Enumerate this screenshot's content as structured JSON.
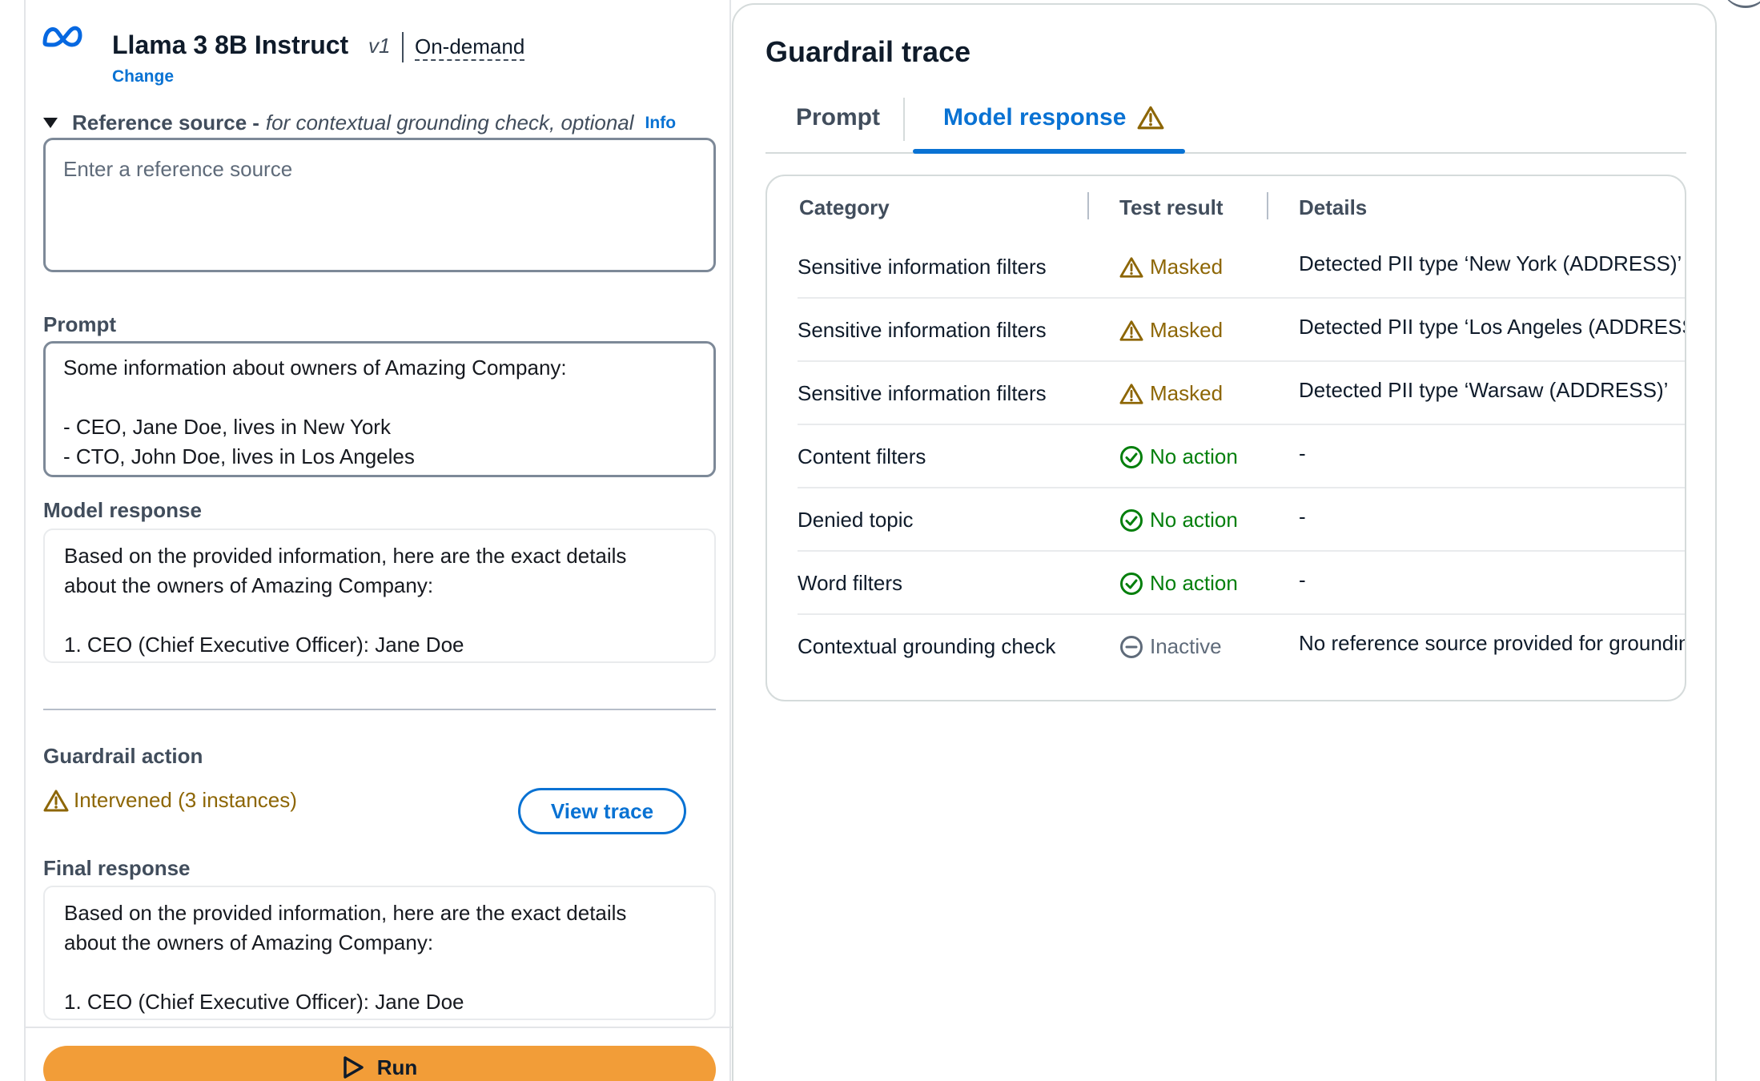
{
  "model": {
    "name": "Llama 3 8B Instruct",
    "version": "v1",
    "mode": "On-demand",
    "change_label": "Change"
  },
  "reference_source": {
    "title": "Reference source",
    "dash": "-",
    "description": "for contextual grounding check, optional",
    "info_label": "Info",
    "placeholder": "Enter a reference source"
  },
  "prompt": {
    "label": "Prompt",
    "lines": [
      "Some information about owners of Amazing Company:",
      "",
      "- CEO, Jane Doe, lives in New York",
      "- CTO, John Doe, lives in Los Angeles"
    ]
  },
  "model_response": {
    "label": "Model response",
    "lines": [
      "Based on the provided information, here are the exact details",
      "about the owners of Amazing Company:",
      "",
      "1. CEO (Chief Executive Officer): Jane Doe"
    ]
  },
  "guardrail_action": {
    "label": "Guardrail action",
    "status_text": "Intervened (3 instances)",
    "view_trace_label": "View trace"
  },
  "final_response": {
    "label": "Final response",
    "lines": [
      "Based on the provided information, here are the exact details",
      "about the owners of Amazing Company:",
      "",
      "1. CEO (Chief Executive Officer): Jane Doe"
    ]
  },
  "run_label": "Run",
  "trace": {
    "title": "Guardrail trace",
    "tabs": [
      {
        "label": "Prompt"
      },
      {
        "label": "Model response"
      }
    ],
    "columns": [
      "Category",
      "Test result",
      "Details"
    ],
    "rows": [
      {
        "category": "Sensitive information filters",
        "result": "Masked",
        "details": "Detected PII type ‘New York (ADDRESS)’"
      },
      {
        "category": "Sensitive information filters",
        "result": "Masked",
        "details": "Detected PII type ‘Los Angeles (ADDRESS)’"
      },
      {
        "category": "Sensitive information filters",
        "result": "Masked",
        "details": "Detected PII type ‘Warsaw (ADDRESS)’"
      },
      {
        "category": "Content filters",
        "result": "No action",
        "details": "-"
      },
      {
        "category": "Denied topic",
        "result": "No action",
        "details": "-"
      },
      {
        "category": "Word filters",
        "result": "No action",
        "details": "-"
      },
      {
        "category": "Contextual grounding check",
        "result": "Inactive",
        "details": "No reference source provided for grounding check"
      }
    ]
  },
  "icons": {
    "logo": "meta-logo",
    "warning": "warning-icon",
    "success": "check-circle-icon",
    "inactive": "minus-circle-icon",
    "play": "play-icon",
    "caret": "caret-down-icon"
  },
  "colors": {
    "link": "#0972d3",
    "warning": "#8d6605",
    "success": "#037f0c",
    "inactive": "#5f6b7a",
    "run_button": "#f29d38"
  }
}
